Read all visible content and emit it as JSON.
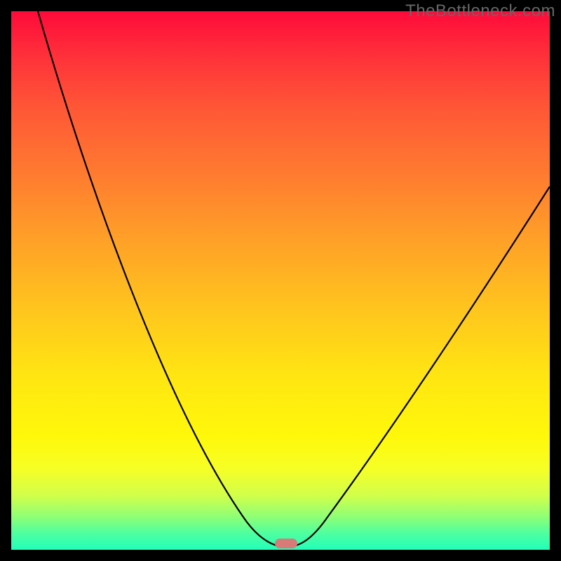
{
  "watermark": "TheBottleneck.com",
  "chart_data": {
    "type": "line",
    "title": "",
    "xlabel": "",
    "ylabel": "",
    "xlim": [
      0,
      100
    ],
    "ylim": [
      0,
      100
    ],
    "series": [
      {
        "name": "curve",
        "x": [
          5,
          10,
          15,
          20,
          25,
          30,
          35,
          40,
          44,
          47,
          49,
          51,
          54,
          58,
          64,
          72,
          80,
          88,
          96,
          100
        ],
        "y": [
          100,
          87,
          74,
          62,
          50,
          39,
          29,
          19,
          11,
          6,
          3,
          1,
          1,
          4,
          10,
          21,
          34,
          48,
          61,
          68
        ]
      }
    ],
    "marker": {
      "x": 51,
      "y": 1
    },
    "gradient_stops": [
      {
        "pos": 0,
        "color": "#ff0a3a"
      },
      {
        "pos": 50,
        "color": "#ffd21a"
      },
      {
        "pos": 100,
        "color": "#22ffba"
      }
    ]
  }
}
